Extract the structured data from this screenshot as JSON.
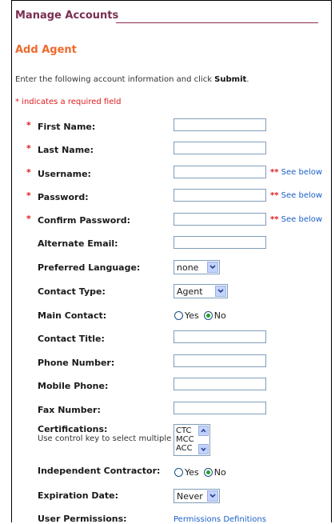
{
  "header": {
    "title": "Manage Accounts"
  },
  "section": {
    "title": "Add Agent"
  },
  "instructions": {
    "prefix": "Enter the following account information and click ",
    "emphasis": "Submit",
    "suffix": "."
  },
  "required_note": "* indicates a required field",
  "required_marker": "*",
  "fields": {
    "first_name": {
      "label": "First Name:",
      "value": ""
    },
    "last_name": {
      "label": "Last Name:",
      "value": ""
    },
    "username": {
      "label": "Username:",
      "value": ""
    },
    "password": {
      "label": "Password:",
      "value": ""
    },
    "confirm_password": {
      "label": "Confirm Password:",
      "value": ""
    },
    "alternate_email": {
      "label": "Alternate Email:",
      "value": ""
    },
    "preferred_language": {
      "label": "Preferred Language:",
      "selected": "none"
    },
    "contact_type": {
      "label": "Contact Type:",
      "selected": "Agent"
    },
    "main_contact": {
      "label": "Main Contact:",
      "yes": "Yes",
      "no": "No",
      "selected": "No"
    },
    "contact_title": {
      "label": "Contact Title:",
      "value": ""
    },
    "phone_number": {
      "label": "Phone Number:",
      "value": ""
    },
    "mobile_phone": {
      "label": "Mobile Phone:",
      "value": ""
    },
    "fax_number": {
      "label": "Fax Number:",
      "value": ""
    },
    "certifications": {
      "label": "Certifications:",
      "hint": "Use control key to select multiple",
      "options": [
        "CTC",
        "MCC",
        "ACC"
      ]
    },
    "independent_contractor": {
      "label": "Independent Contractor:",
      "yes": "Yes",
      "no": "No",
      "selected": "No"
    },
    "expiration_date": {
      "label": "Expiration Date:",
      "selected": "Never"
    },
    "user_permissions": {
      "label": "User Permissions:",
      "link": "Permissions Definitions"
    }
  },
  "see_below": {
    "marker": "**",
    "text": " See below"
  },
  "icons": {
    "dropdown": "chevron-down-icon",
    "scroll_up": "scroll-up-arrow-icon",
    "scroll_down": "scroll-down-arrow-icon"
  },
  "colors": {
    "header": "#7a2e52",
    "section": "#ee6a2c",
    "required": "#e01b1b",
    "link": "#1b60c8",
    "radio_on": "#21a121"
  }
}
